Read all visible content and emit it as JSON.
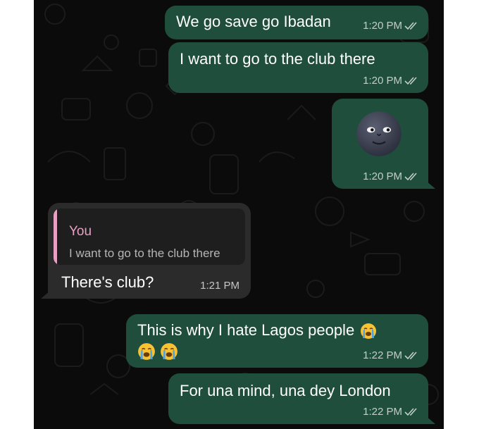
{
  "messages": [
    {
      "text": "We go save go Ibadan",
      "time": "1:20 PM"
    },
    {
      "text": "I want to go to the club there",
      "time": "1:20 PM"
    },
    {
      "emoji": "new-moon-face",
      "time": "1:20 PM"
    },
    {
      "reply_author": "You",
      "reply_text": "I want to go to the club there",
      "text": "There's club?",
      "time": "1:21 PM"
    },
    {
      "text": "This is why I hate Lagos people",
      "emojis": [
        "loudly-crying-face",
        "loudly-crying-face",
        "loudly-crying-face"
      ],
      "time": "1:22 PM"
    },
    {
      "text": "For una mind, una dey London",
      "time": "1:22 PM"
    }
  ],
  "colors": {
    "background": "#0b0b0b",
    "outgoing_bubble": "#1f4e3d",
    "incoming_bubble": "#2b2b2b",
    "reply_author": "#e8a1c4",
    "reply_bar": "#e8a1c4"
  }
}
